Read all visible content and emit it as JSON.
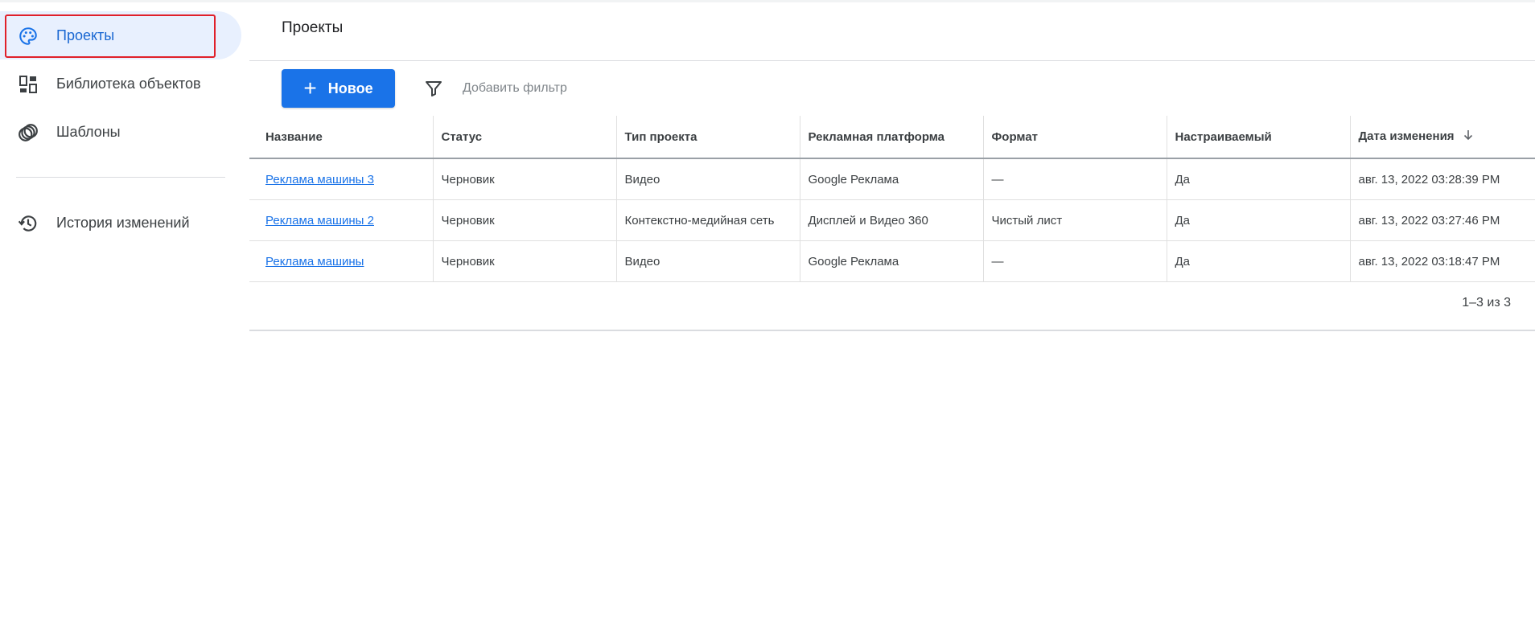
{
  "sidebar": {
    "items": [
      {
        "label": "Проекты",
        "icon": "palette-icon",
        "active": true
      },
      {
        "label": "Библиотека объектов",
        "icon": "dashboard-icon"
      },
      {
        "label": "Шаблоны",
        "icon": "template-icon"
      },
      {
        "label": "История изменений",
        "icon": "history-icon"
      }
    ]
  },
  "header": {
    "title": "Проекты"
  },
  "toolbar": {
    "new_button": "Новое",
    "new_icon": "plus-icon",
    "filter_icon": "filter-icon",
    "add_filter": "Добавить фильтр"
  },
  "table": {
    "columns": [
      "Название",
      "Статус",
      "Тип проекта",
      "Рекламная платформа",
      "Формат",
      "Настраиваемый",
      "Дата изменения"
    ],
    "sort_column": "Дата изменения",
    "sort_direction": "desc",
    "rows": [
      [
        "Реклама машины 3",
        "Черновик",
        "Видео",
        "Google Реклама",
        "—",
        "Да",
        "авг. 13, 2022 03:28:39 PM"
      ],
      [
        "Реклама машины 2",
        "Черновик",
        "Контекстно-медийная сеть",
        "Дисплей и Видео 360",
        "Чистый лист",
        "Да",
        "авг. 13, 2022 03:27:46 PM"
      ],
      [
        "Реклама машины",
        "Черновик",
        "Видео",
        "Google Реклама",
        "—",
        "Да",
        "авг. 13, 2022 03:18:47 PM"
      ]
    ]
  },
  "pagination": {
    "text": "1–3 из 3"
  },
  "colors": {
    "accent": "#1a73e8",
    "active_bg": "#e8f0fe",
    "focus_outline": "#e0202a"
  }
}
